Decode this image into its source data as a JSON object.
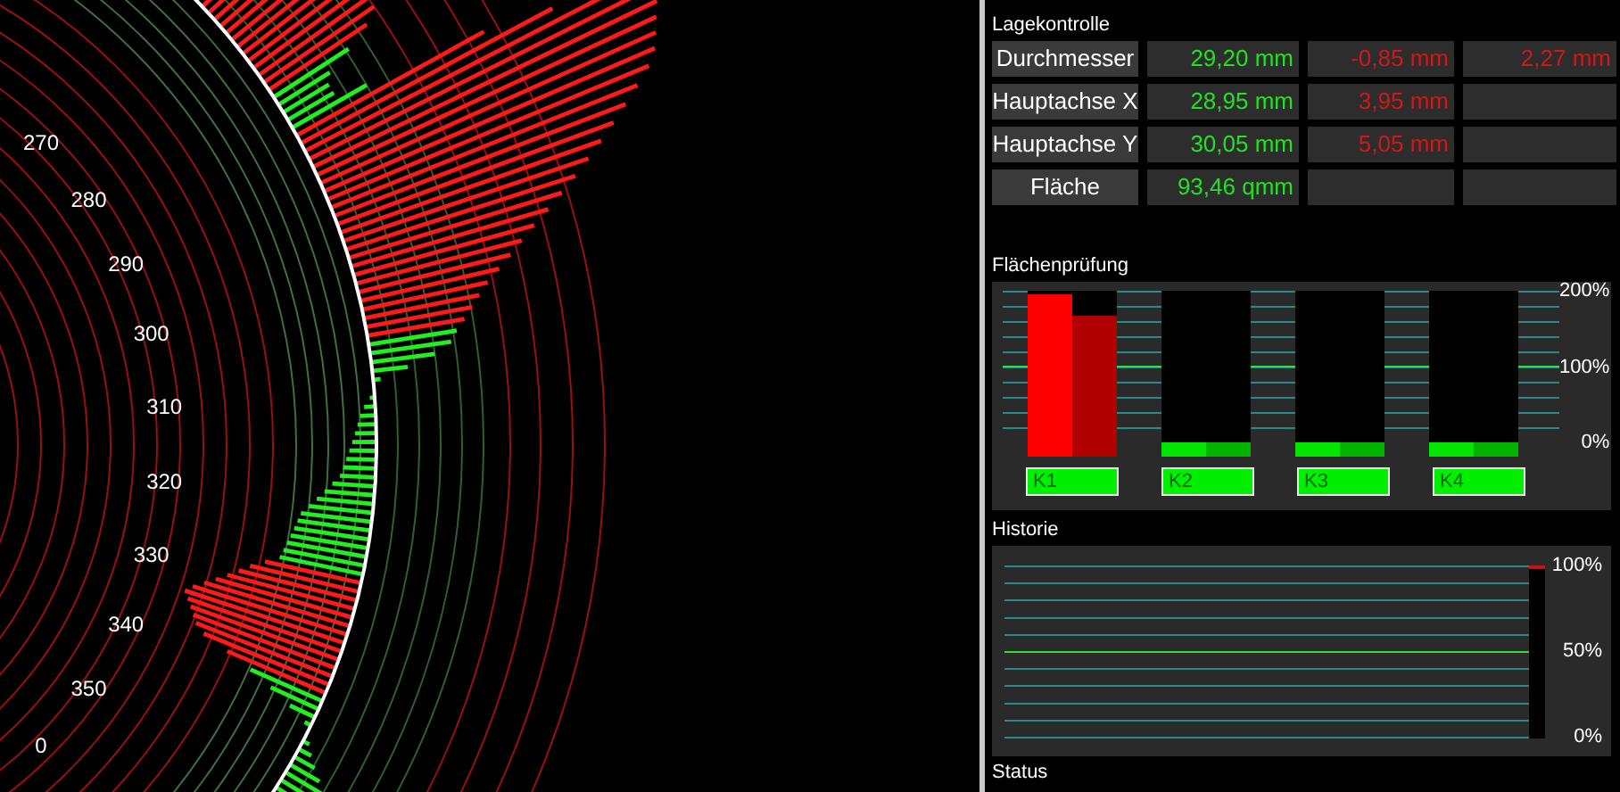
{
  "polar_plot": {
    "angle_labels": [
      "270",
      "280",
      "290",
      "300",
      "310",
      "320",
      "330",
      "340",
      "350",
      "0"
    ]
  },
  "position_check": {
    "title": "Lagekontrolle",
    "rows": [
      {
        "label": "Durchmesser",
        "cells": [
          {
            "text": "29,20 mm",
            "kind": "ok"
          },
          {
            "text": "-0,85 mm",
            "kind": "error"
          },
          {
            "text": "2,27 mm",
            "kind": "error"
          }
        ]
      },
      {
        "label": "Hauptachse X",
        "cells": [
          {
            "text": "28,95 mm",
            "kind": "ok"
          },
          {
            "text": "3,95 mm",
            "kind": "error"
          }
        ]
      },
      {
        "label": "Hauptachse Y",
        "cells": [
          {
            "text": "30,05 mm",
            "kind": "ok"
          },
          {
            "text": "5,05 mm",
            "kind": "error"
          }
        ]
      },
      {
        "label": "Fläche",
        "cells": [
          {
            "text": "93,46 qmm",
            "kind": "ok"
          }
        ]
      }
    ]
  },
  "area_check": {
    "title": "Flächenprüfung",
    "axis_labels": [
      "200%",
      "100%",
      "0%"
    ],
    "channels": [
      {
        "label": "K1",
        "bars": [
          {
            "level": 1,
            "alarm": true
          },
          {
            "level": 0.85,
            "alarm": true
          }
        ]
      },
      {
        "label": "K2",
        "bars": [
          {
            "level": 0,
            "alarm": false
          },
          {
            "level": 0,
            "alarm": false
          }
        ]
      },
      {
        "label": "K3",
        "bars": [
          {
            "level": 0,
            "alarm": false
          },
          {
            "level": 0,
            "alarm": false
          }
        ]
      },
      {
        "label": "K4",
        "bars": [
          {
            "level": 0,
            "alarm": false
          },
          {
            "level": 0,
            "alarm": false
          }
        ]
      }
    ]
  },
  "history": {
    "title": "Historie",
    "axis_labels": [
      "100%",
      "50%",
      "0%"
    ]
  },
  "status": {
    "title": "Status"
  }
}
